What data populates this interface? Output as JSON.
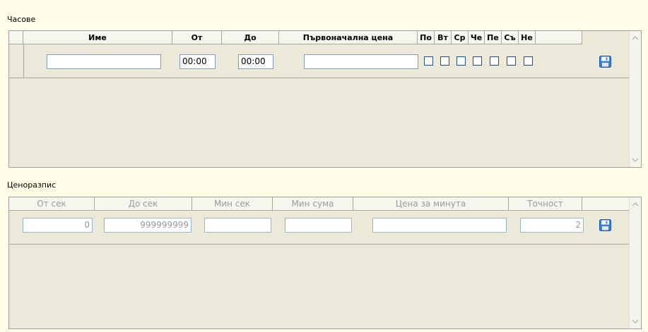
{
  "hours": {
    "title": "Часове",
    "columns": [
      "Име",
      "От",
      "До",
      "Първоначална цена",
      "По",
      "Вт",
      "Ср",
      "Че",
      "Пе",
      "Съ",
      "Не"
    ],
    "row": {
      "name": "",
      "from": "00:00",
      "to": "00:00",
      "initial_price": "",
      "days": [
        false,
        false,
        false,
        false,
        false,
        false,
        false
      ]
    }
  },
  "pricelist": {
    "title": "Ценоразпис",
    "columns": [
      "От сек",
      "До сек",
      "Мин сек",
      "Мин сума",
      "Цена за минута",
      "Точност"
    ],
    "row": {
      "from_sec": "0",
      "to_sec": "999999999",
      "min_sec": "",
      "min_sum": "",
      "price_per_minute": "",
      "precision": "2"
    }
  },
  "icons": {
    "save": "floppy-disk-icon",
    "scroll_up": "arrow-up-icon",
    "scroll_down": "arrow-down-icon"
  },
  "colors": {
    "background": "#fffee8",
    "grid": "#ece9d8",
    "save_icon": "#3d7fd1"
  }
}
